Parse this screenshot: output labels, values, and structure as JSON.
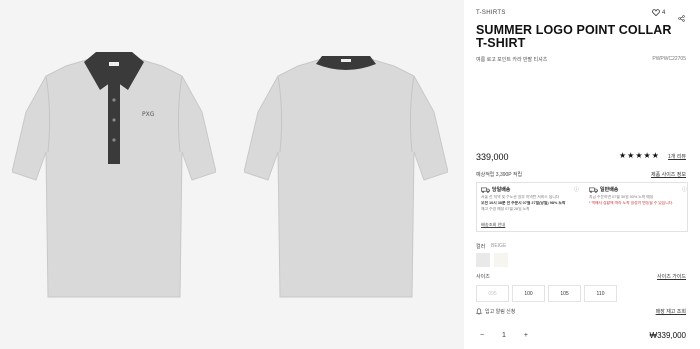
{
  "product": {
    "breadcrumb": "T-SHIRTS",
    "title": "SUMMER LOGO POINT COLLAR T-SHIRT",
    "subtitle": "여름 로고 포인트 카라 반팔 티셔츠",
    "code": "PWPWC22705",
    "wishlist_count": "4",
    "price": "339,000",
    "rating_stars": 5,
    "review_link": "1개 리뷰",
    "points_text": "예상적립 3,390P 적립",
    "size_table_link": "제품 사이즈 정보",
    "delivery": {
      "left_title": "당일배송",
      "left_lines": [
        "서울 전 지역 및 수도권 일부 지역만 서비스 됩니다",
        "오전 10시 38분 전 주문시 07월 27일(당일) 98% 도착",
        "재고 수령 예정 07월 28일 도착"
      ],
      "right_title": "일반배송",
      "right_lines": [
        "지금 주문하면 07월 30일 90% 도착 예정",
        "* 택배사 상황에 따라 도착 일정이 변동될 수 있습니다."
      ],
      "footer_link": "배송조회 안내"
    },
    "color_label": "컬러",
    "color_name": "BEIGE",
    "size_label": "사이즈",
    "size_guide": "사이즈 가이드",
    "sizes": [
      {
        "label": "095",
        "available": false
      },
      {
        "label": "100",
        "available": true
      },
      {
        "label": "105",
        "available": true
      },
      {
        "label": "110",
        "available": true
      }
    ],
    "restock_label": "입고 알림 신청",
    "store_link": "매장 재고 조회",
    "quantity": "1",
    "total": "₩339,000"
  },
  "icons": {
    "wishlist": "heart-icon",
    "share": "share-icon",
    "truck": "truck-icon",
    "info": "info-icon",
    "bell": "bell-icon"
  },
  "colors": {
    "shirt_body": "#d9d9d9",
    "collar": "#3a3a3a",
    "gallery_bg": "#f4f4f4"
  }
}
